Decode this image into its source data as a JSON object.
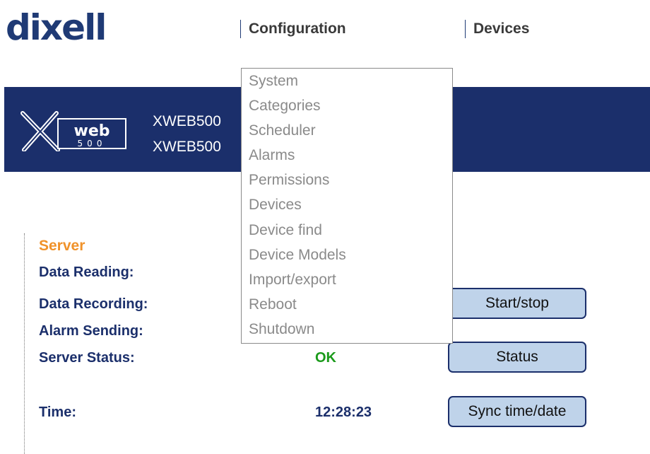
{
  "logo": {
    "text": "dixell",
    "color": "#1f3a75"
  },
  "nav": {
    "configuration": "Configuration",
    "devices": "Devices"
  },
  "banner": {
    "background": "#1b2f6b",
    "line1": "XWEB500",
    "line2": "XWEB500",
    "product_logo": {
      "top": "web",
      "bottom": "500"
    }
  },
  "dropdown": {
    "items": [
      "System",
      "Categories",
      "Scheduler",
      "Alarms",
      "Permissions",
      "Devices",
      "Device find",
      "Device Models",
      "Import/export",
      "Reboot",
      "Shutdown"
    ]
  },
  "server": {
    "title": "Server",
    "data_reading_label": "Data Reading:",
    "data_recording_label": "Data Recording:",
    "alarm_sending_label": "Alarm Sending:",
    "server_status_label": "Server Status:",
    "server_status_value": "OK",
    "time_label": "Time:",
    "time_value": "12:28:23"
  },
  "buttons": {
    "start_stop": "Start/stop",
    "status": "Status",
    "sync": "Sync time/date"
  },
  "colors": {
    "accent": "#f0922a",
    "ok": "#1a9a1a",
    "button_bg": "#bfd3ea",
    "label": "#1b2f6b"
  }
}
